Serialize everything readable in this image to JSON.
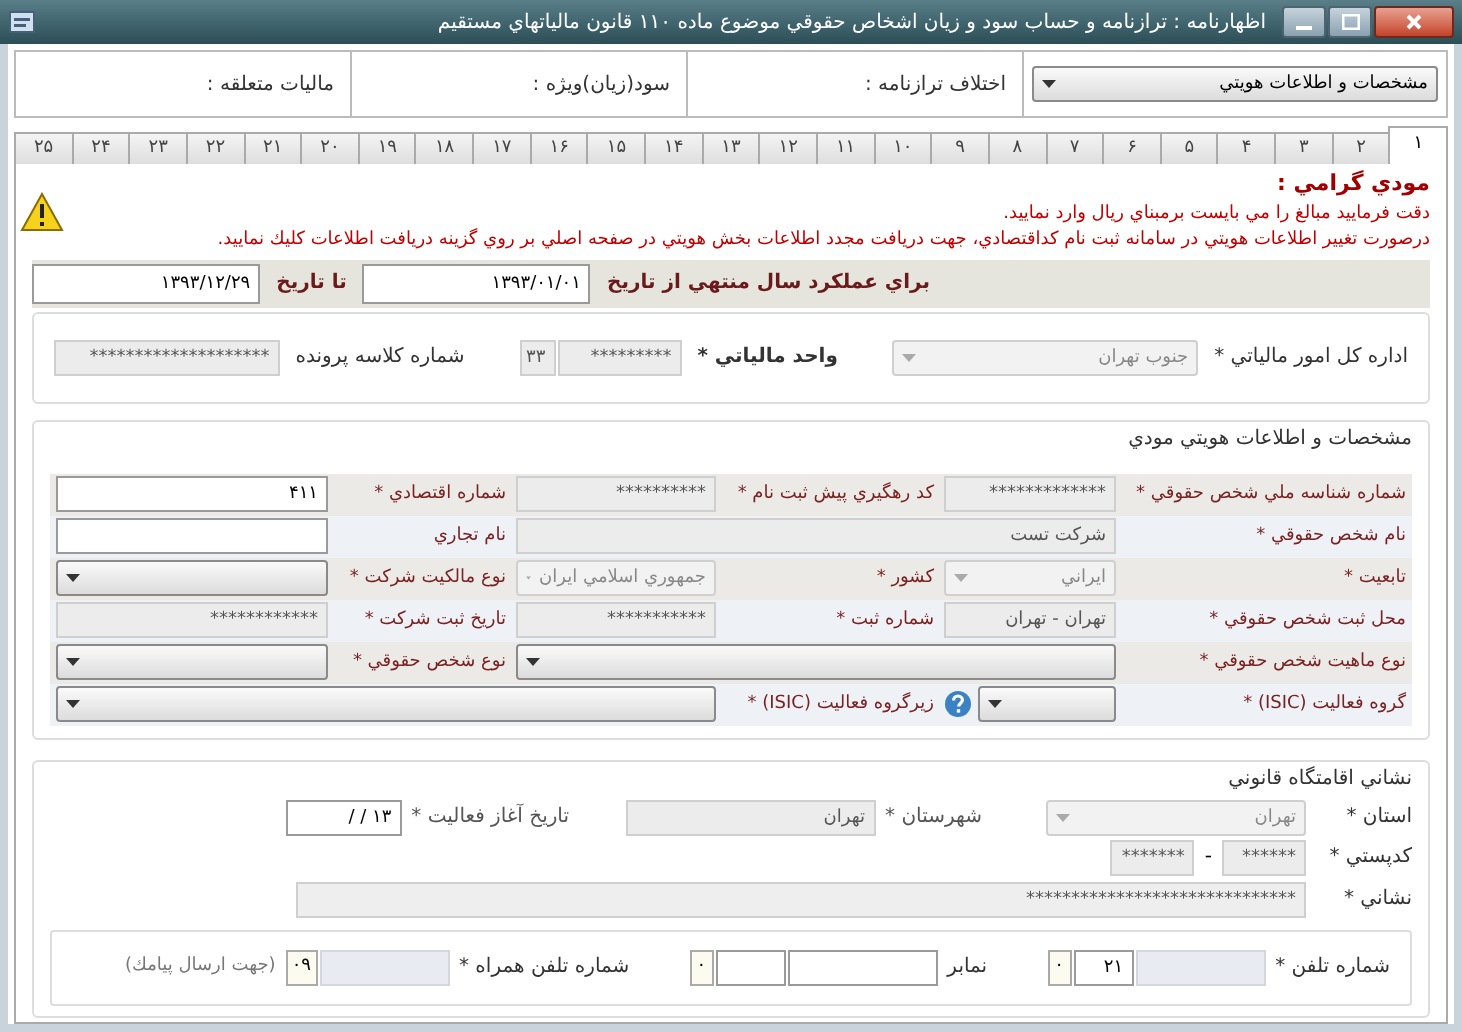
{
  "window": {
    "title": "اظهارنامه : ترازنامه و حساب سود و زيان اشخاص حقوقي موضوع ماده ۱۱۰ قانون مالياتهاي مستقيم"
  },
  "header": {
    "section_select": "مشخصات و اطلاعات هويتي",
    "cells": [
      "اختلاف ترازنامه :",
      "سود(زيان)ويژه :",
      "ماليات متعلقه :"
    ]
  },
  "tabs": [
    {
      "label": "۱",
      "selected": true
    },
    {
      "label": "۲",
      "selected": false
    },
    {
      "label": "۳",
      "selected": false
    },
    {
      "label": "۴",
      "selected": false
    },
    {
      "label": "۵",
      "selected": false
    },
    {
      "label": "۶",
      "selected": false
    },
    {
      "label": "۷",
      "selected": false
    },
    {
      "label": "۸",
      "selected": false
    },
    {
      "label": "۹",
      "selected": false
    },
    {
      "label": "۱۰",
      "selected": false
    },
    {
      "label": "۱۱",
      "selected": false
    },
    {
      "label": "۱۲",
      "selected": false
    },
    {
      "label": "۱۳",
      "selected": false
    },
    {
      "label": "۱۴",
      "selected": false
    },
    {
      "label": "۱۵",
      "selected": false
    },
    {
      "label": "۱۶",
      "selected": false
    },
    {
      "label": "۱۷",
      "selected": false
    },
    {
      "label": "۱۸",
      "selected": false
    },
    {
      "label": "۱۹",
      "selected": false
    },
    {
      "label": "۲۰",
      "selected": false
    },
    {
      "label": "۲۱",
      "selected": false
    },
    {
      "label": "۲۲",
      "selected": false
    },
    {
      "label": "۲۳",
      "selected": false
    },
    {
      "label": "۲۴",
      "selected": false
    },
    {
      "label": "۲۵",
      "selected": false
    }
  ],
  "notice": {
    "title": "مودي گرامي :",
    "lines": [
      "دقت فرماييد مبالغ را مي بايست برمبناي ريال وارد نماييد.",
      "درصورت تغيير اطلاعات هويتي در سامانه ثبت نام كداقتصادي، جهت دريافت مجدد اطلاعات بخش هويتي در صفحه اصلي بر روي گزينه دريافت اطلاعات كليك نماييد."
    ]
  },
  "period": {
    "from_label": "براي عملكرد سال منتهي از تاريخ",
    "from_value": "۱۳۹۳/۰۱/۰۱",
    "to_label": "تا تاريخ",
    "to_value": "۱۳۹۳/۱۲/۲۹"
  },
  "office": {
    "office_label": "اداره كل امور مالياتي *",
    "office_value": "جنوب تهران",
    "unit_label": "واحد مالياتي *",
    "unit_value": "*********",
    "unit_code": "۳۳",
    "file_label": "شماره كلاسه پرونده",
    "file_value": "********************"
  },
  "identity": {
    "title": "مشخصات و اطلاعات هويتي مودي",
    "rows": [
      [
        {
          "label": "شماره شناسه ملي شخص حقوقي *",
          "kind": "input",
          "value": "*************",
          "disabled": true
        },
        {
          "label": "كد رهگيري پيش ثبت نام *",
          "kind": "input",
          "value": "**********",
          "disabled": true
        },
        {
          "label": "شماره اقتصادي *",
          "kind": "input",
          "value": "۴۱۱",
          "disabled": false
        }
      ],
      [
        {
          "label": "نام شخص حقوقي *",
          "kind": "wide",
          "value": "شركت تست",
          "disabled": true
        },
        {
          "label": "نام تجاري",
          "kind": "input",
          "disabled": false
        }
      ],
      [
        {
          "label": "تابعيت *",
          "kind": "select",
          "value": "ايراني",
          "disabled": true
        },
        {
          "label": "كشور *",
          "kind": "select",
          "value": "جمهوري اسلامي ايران",
          "disabled": true
        },
        {
          "label": "نوع مالكيت شركت *",
          "kind": "select",
          "disabled": false
        }
      ],
      [
        {
          "label": "محل ثبت شخص حقوقي *",
          "kind": "input",
          "value": "تهران - تهران",
          "disabled": true
        },
        {
          "label": "شماره ثبت *",
          "kind": "input",
          "value": "***********",
          "disabled": true
        },
        {
          "label": "تاريخ ثبت شركت *",
          "kind": "input",
          "value": "************",
          "disabled": true
        }
      ],
      [
        {
          "label": "نوع ماهيت شخص حقوقي *",
          "kind": "wideselect",
          "disabled": false
        },
        {
          "label": "نوع شخص حقوقي *",
          "kind": "select",
          "disabled": false
        }
      ],
      [
        {
          "label": "گروه فعاليت (ISIC) *",
          "kind": "select",
          "disabled": false,
          "help": true
        },
        {
          "label": "زيرگروه فعاليت (ISIC) *",
          "kind": "wideselect",
          "disabled": false
        }
      ]
    ]
  },
  "address": {
    "title": "نشاني اقامتگاه قانوني",
    "province_label": "استان *",
    "province_value": "تهران",
    "city_label": "شهرستان *",
    "city_value": "تهران",
    "start_label": "تاريخ آغاز فعاليت *",
    "start_value": "۱۳ / /",
    "postal_label": "كدپستي *",
    "postal_parts": [
      "******",
      "*******"
    ],
    "postal_separator": "-",
    "street_label": "نشاني *",
    "street_value": "******************************"
  },
  "contact": [
    {
      "label": "شماره تلفن *",
      "parts": [
        {
          "kind": "blurred"
        },
        {
          "kind": "input",
          "value": "۲۱"
        },
        {
          "kind": "prefix",
          "value": "۰"
        }
      ]
    },
    {
      "label": "نمابر",
      "parts": [
        {
          "kind": "input"
        },
        {
          "kind": "short"
        },
        {
          "kind": "prefix",
          "value": "۰"
        }
      ]
    },
    {
      "label": "شماره تلفن همراه *",
      "parts": [
        {
          "kind": "blurred"
        },
        {
          "kind": "prefix",
          "value": "۰۹"
        }
      ],
      "hint": "(جهت ارسال پيامك)"
    }
  ]
}
